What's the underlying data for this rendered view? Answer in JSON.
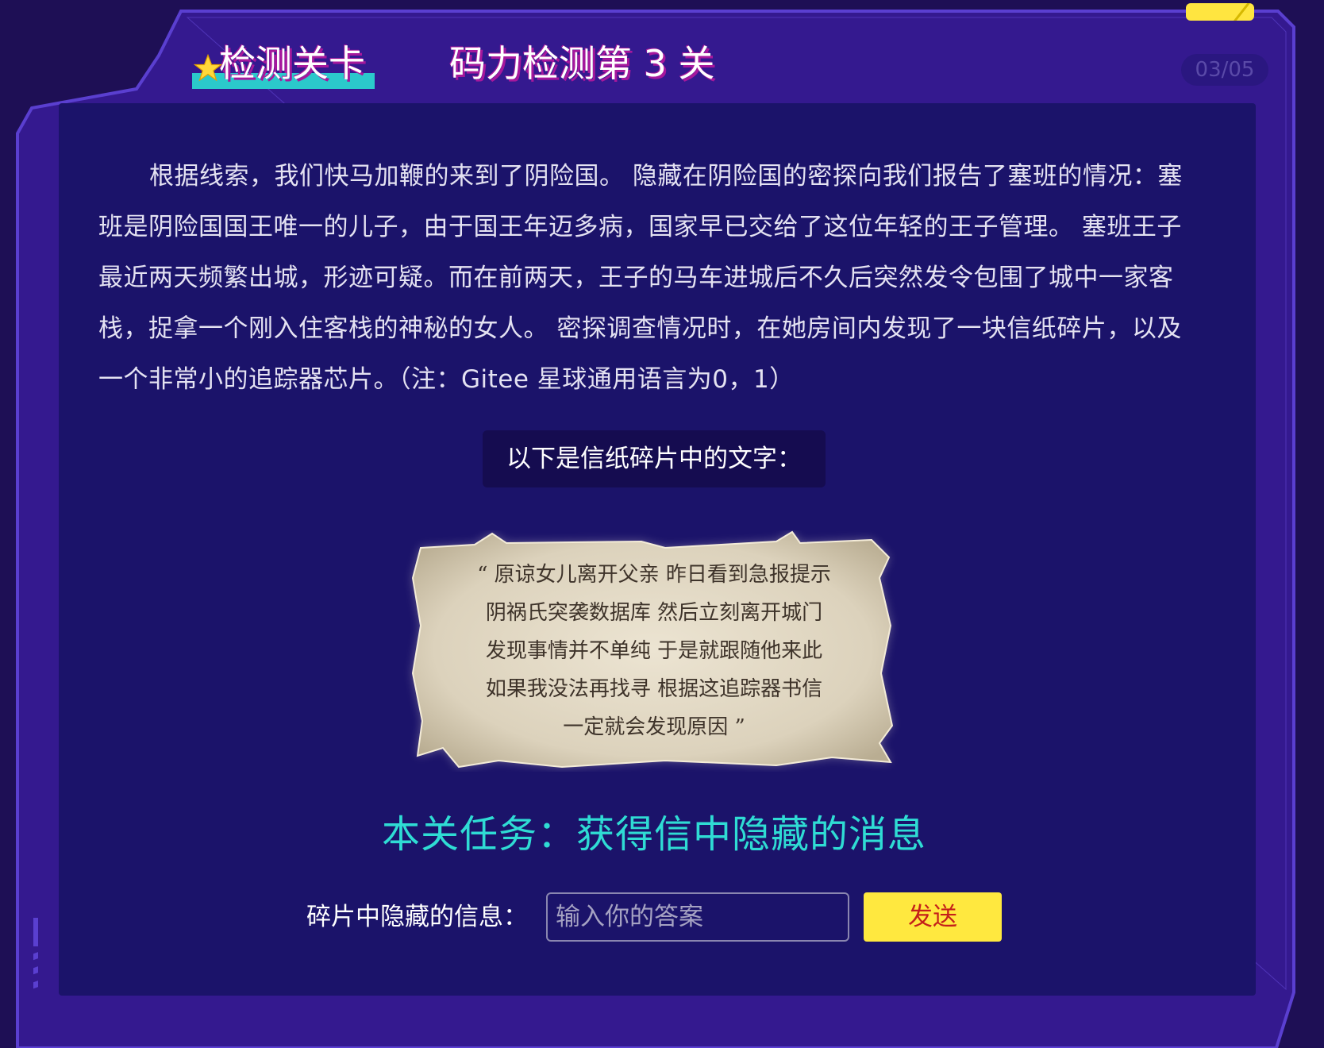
{
  "header": {
    "badge_title": "检测关卡",
    "level_title": "码力检测第 3 关",
    "progress": "03/05"
  },
  "story": {
    "paragraph": "根据线索，我们快马加鞭的来到了阴险国。 隐藏在阴险国的密探向我们报告了塞班的情况：塞班是阴险国国王唯一的儿子，由于国王年迈多病，国家早已交给了这位年轻的王子管理。 塞班王子最近两天频繁出城，形迹可疑。而在前两天，王子的马车进城后不久后突然发令包围了城中一家客栈，捉拿一个刚入住客栈的神秘的女人。 密探调查情况时，在她房间内发现了一块信纸碎片，以及一个非常小的追踪器芯片。（注：Gitee 星球通用语言为0，1）"
  },
  "fragment": {
    "label": "以下是信纸碎片中的文字：",
    "lines": [
      "“ 原谅女儿离开父亲   昨日看到急报提示",
      "阴祸氏突袭数据库  然后立刻离开城门",
      "发现事情并不单纯  于是就跟随他来此",
      "如果我没法再找寻  根据这追踪器书信",
      "一定就会发现原因    ”"
    ]
  },
  "task": {
    "text": "本关任务：获得信中隐藏的消息"
  },
  "answer": {
    "label": "碎片中隐藏的信息：",
    "placeholder": "输入你的答案",
    "value": "",
    "send_label": "发送"
  },
  "colors": {
    "background": "#1e0f55",
    "frame": "#34198f",
    "frame_border": "#5a3fd0",
    "panel": "#1b136a",
    "accent_cyan": "#2fdcd4",
    "accent_yellow": "#ffe83f",
    "button_text": "#c4201a",
    "title_shadow": "#a6189c"
  },
  "icons": {
    "badge_icon": "star-icon",
    "top_right_tab": "yellow-tab"
  }
}
